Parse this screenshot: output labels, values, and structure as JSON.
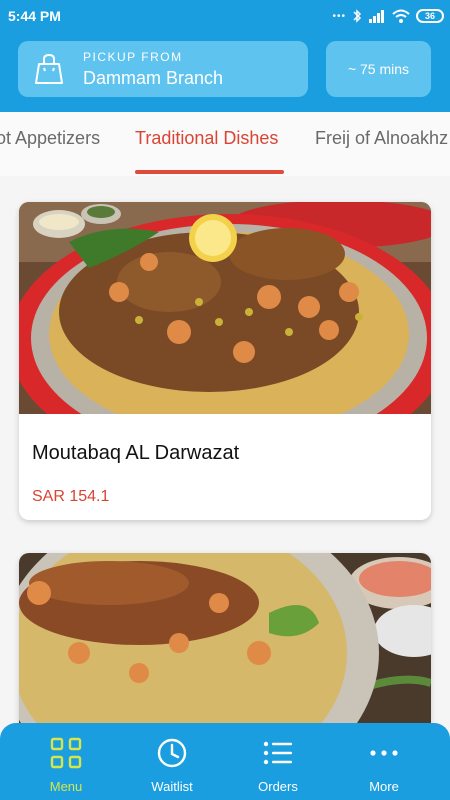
{
  "status_bar": {
    "time": "5:44 PM",
    "battery": "36"
  },
  "header": {
    "pickup_label": "PICKUP FROM",
    "branch": "Dammam Branch",
    "eta": "~ 75 mins"
  },
  "tabs": [
    {
      "label": "ot Appetizers"
    },
    {
      "label": "Traditional Dishes",
      "active": true
    },
    {
      "label": "Freij of Alnoakhz"
    }
  ],
  "items": [
    {
      "name": "Moutabaq AL Darwazat",
      "price": "SAR 154.1"
    },
    {
      "name": "",
      "price": ""
    }
  ],
  "bottom_nav": [
    {
      "label": "Menu",
      "icon": "grid-icon",
      "active": true
    },
    {
      "label": "Waitlist",
      "icon": "clock-icon"
    },
    {
      "label": "Orders",
      "icon": "list-icon"
    },
    {
      "label": "More",
      "icon": "more-icon"
    }
  ],
  "colors": {
    "primary": "#1a9ee0",
    "accent": "#d94434",
    "nav_active": "#d6e64a",
    "header_card": "#5ec3ee"
  }
}
